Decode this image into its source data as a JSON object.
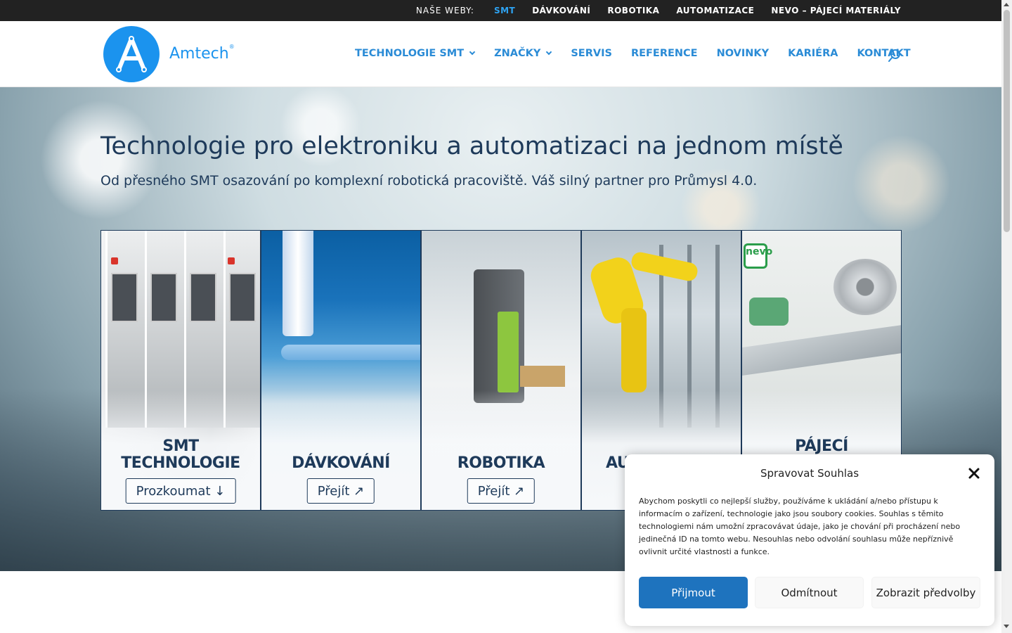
{
  "topbar": {
    "label": "NAŠE WEBY:",
    "links": [
      "SMT",
      "DÁVKOVÁNÍ",
      "ROBOTIKA",
      "AUTOMATIZACE",
      "NEVO – PÁJECÍ MATERIÁLY"
    ],
    "active_index": 0
  },
  "header": {
    "logo_text": "Amtech",
    "logo_mark": "®",
    "nav": [
      {
        "label": "TECHNOLOGIE SMT",
        "has_dropdown": true
      },
      {
        "label": "ZNAČKY",
        "has_dropdown": true
      },
      {
        "label": "SERVIS",
        "has_dropdown": false
      },
      {
        "label": "REFERENCE",
        "has_dropdown": false
      },
      {
        "label": "NOVINKY",
        "has_dropdown": false
      },
      {
        "label": "KARIÉRA",
        "has_dropdown": false
      },
      {
        "label": "KONTAKT",
        "has_dropdown": false
      }
    ],
    "search_icon": "search-icon"
  },
  "hero": {
    "title": "Technologie pro elektroniku a automatizaci na jednom místě",
    "subtitle": "Od přesného SMT osazování po komplexní robotická pracoviště. Váš silný partner pro Průmysl 4.0."
  },
  "cards": [
    {
      "title_line1": "SMT",
      "title_line2": "TECHNOLOGIE",
      "button": "Prozkoumat ↓"
    },
    {
      "title_line1": "DÁVKOVÁNÍ",
      "title_line2": "",
      "button": "Přejít ↗"
    },
    {
      "title_line1": "ROBOTIKA",
      "title_line2": "",
      "button": "Přejít ↗"
    },
    {
      "title_line1": "AU",
      "title_line2": "",
      "button": ""
    },
    {
      "title_line1": "PÁJECÍ",
      "title_line2": "",
      "button": ""
    }
  ],
  "card_art": {
    "nevo_logo_text": "nevo"
  },
  "cookie": {
    "title": "Spravovat Souhlas",
    "text": "Abychom poskytli co nejlepší služby, používáme k ukládání a/nebo přístupu k informacím o zařízení, technologie jako jsou soubory cookies. Souhlas s těmito technologiemi nám umožní zpracovávat údaje, jako je chování při procházení nebo jedinečná ID na tomto webu. Nesouhlas nebo odvolání souhlasu může nepříznivě ovlivnit určité vlastnosti a funkce.",
    "accept": "Přijmout",
    "deny": "Odmítnout",
    "prefs": "Zobrazit předvolby"
  },
  "colors": {
    "topbar_bg": "#222222",
    "topbar_active": "#2ea3f2",
    "brand_blue": "#1b93ee",
    "nav_blue": "#2a8bd6",
    "heading_navy": "#1e3a5a",
    "accept_button": "#1e73be"
  }
}
